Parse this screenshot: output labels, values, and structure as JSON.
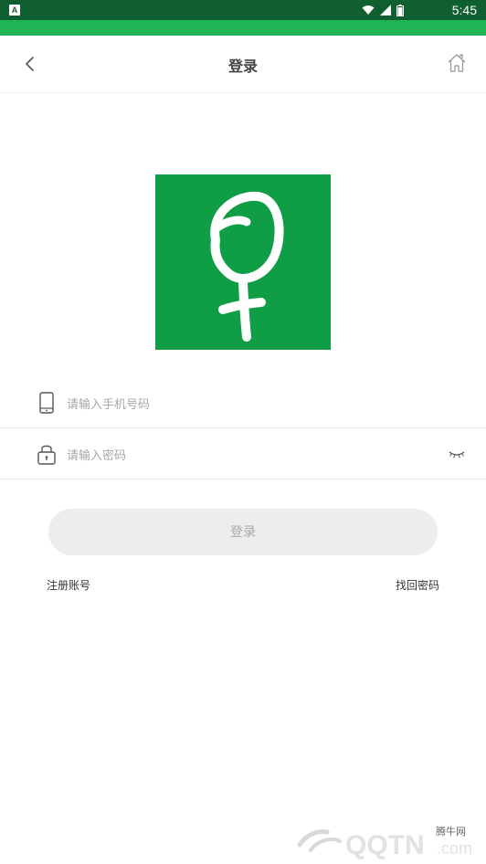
{
  "status_bar": {
    "time": "5:45",
    "app_badge": "A",
    "icons": [
      "wifi-icon",
      "signal-icon",
      "battery-icon"
    ]
  },
  "colors": {
    "status_bar": "#0f5f30",
    "accent_green": "#1fb454",
    "logo_bg": "#0f9d45",
    "button_bg": "#ededed",
    "placeholder": "#a8a8a8"
  },
  "nav": {
    "title": "登录",
    "back_icon": "chevron-left-icon",
    "home_icon": "home-icon"
  },
  "form": {
    "phone_placeholder": "请输入手机号码",
    "phone_value": "",
    "password_placeholder": "请输入密码",
    "password_value": "",
    "login_label": "登录"
  },
  "links": {
    "register": "注册账号",
    "forgot_password": "找回密码"
  },
  "watermark": {
    "text": "腾牛网"
  }
}
